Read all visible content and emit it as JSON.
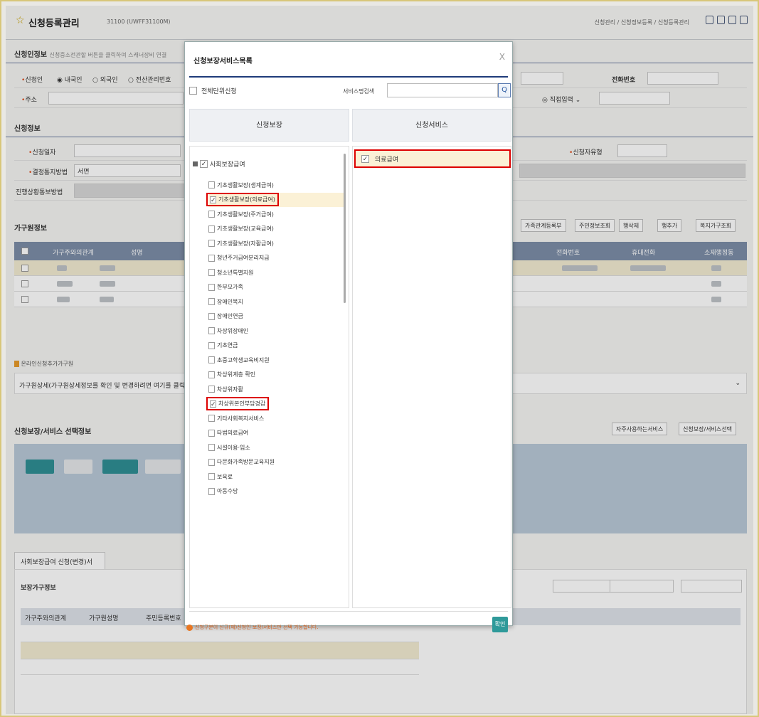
{
  "page": {
    "title": "신청등록관리",
    "code": "31100 (UWFF31100M)",
    "breadcrumb": "신청관리 / 신청정보등록 / 신청등록관리"
  },
  "applicant": {
    "heading": "신청인정보",
    "note": "신청중소전관할 버튼을 클릭하여 스캐너장비 연결",
    "applicant_label": "신청인",
    "domestic": "내국인",
    "foreign": "외국인",
    "mgmt": "전산관리번호",
    "address_label": "주소",
    "phone_label": "전화번호",
    "direct_input": "직접입력"
  },
  "application": {
    "heading": "신청정보",
    "date_label": "신청일자",
    "reason_label": "신청자유형",
    "notify_label": "결정통지방법",
    "notify_value": "서면",
    "progress_label": "진행상황통보방법"
  },
  "household": {
    "heading": "가구원정보",
    "buttons": [
      "가족관계등록부",
      "주민정보조회",
      "행삭제",
      "행추가",
      "복지가구조회"
    ],
    "cols": [
      "가구주와의관계",
      "성명",
      "전화번호",
      "휴대전화",
      "소재행정동"
    ]
  },
  "online": {
    "heading": "온라인신청추가가구원",
    "notice": "가구원상세(가구원상세정보를 확인 및 변경하려면 여기를 클릭"
  },
  "service_sel": {
    "heading": "신청보장/서비스 선택정보",
    "btn_frequent": "자주사용하는서비스",
    "btn_select": "신청보장/서비스선택"
  },
  "bottom": {
    "tab": "사회보장급여 신청(변경)서",
    "sub_heading": "보장가구정보",
    "cols": [
      "가구주와의관계",
      "가구원성명",
      "주민등록번호"
    ]
  },
  "modal": {
    "title": "신청보장서비스목록",
    "close": "X",
    "all_label": "전체단위신청",
    "search_label": "서비스명검색",
    "search_btn": "Q",
    "col_left": "신청보장",
    "col_right": "신청서비스",
    "root": "사회보장급여",
    "items": [
      {
        "label": "기초생활보장(생계급여)",
        "checked": false,
        "highlight": false
      },
      {
        "label": "기초생활보장(의료급여)",
        "checked": true,
        "highlight": true
      },
      {
        "label": "기초생활보장(주거급여)",
        "checked": false,
        "highlight": false
      },
      {
        "label": "기초생활보장(교육급여)",
        "checked": false,
        "highlight": false
      },
      {
        "label": "기초생활보장(자활급여)",
        "checked": false,
        "highlight": false
      },
      {
        "label": "청년주거급여분리지급",
        "checked": false,
        "highlight": false
      },
      {
        "label": "청소년특별지원",
        "checked": false,
        "highlight": false
      },
      {
        "label": "한부모가족",
        "checked": false,
        "highlight": false
      },
      {
        "label": "장애인복지",
        "checked": false,
        "highlight": false
      },
      {
        "label": "장애인연금",
        "checked": false,
        "highlight": false
      },
      {
        "label": "차상위장애인",
        "checked": false,
        "highlight": false
      },
      {
        "label": "기초연금",
        "checked": false,
        "highlight": false
      },
      {
        "label": "초중고학생교육비지원",
        "checked": false,
        "highlight": false
      },
      {
        "label": "차상위계층 확인",
        "checked": false,
        "highlight": false
      },
      {
        "label": "차상위자활",
        "checked": false,
        "highlight": false
      },
      {
        "label": "차상위본인부담경감",
        "checked": true,
        "highlight": false
      },
      {
        "label": "기타사회복지서비스",
        "checked": false,
        "highlight": false
      },
      {
        "label": "타법의료급여",
        "checked": false,
        "highlight": false
      },
      {
        "label": "시설이용·입소",
        "checked": false,
        "highlight": false
      },
      {
        "label": "다문화가족방문교육지원",
        "checked": false,
        "highlight": false
      },
      {
        "label": "보육료",
        "checked": false,
        "highlight": false
      },
      {
        "label": "아동수당",
        "checked": false,
        "highlight": false
      }
    ],
    "selected": [
      {
        "label": "의료급여",
        "checked": true
      }
    ],
    "warning": "신청구분이 신규(재)신청인 보장/서비스만 선택 가능합니다.",
    "ok": "확인"
  }
}
